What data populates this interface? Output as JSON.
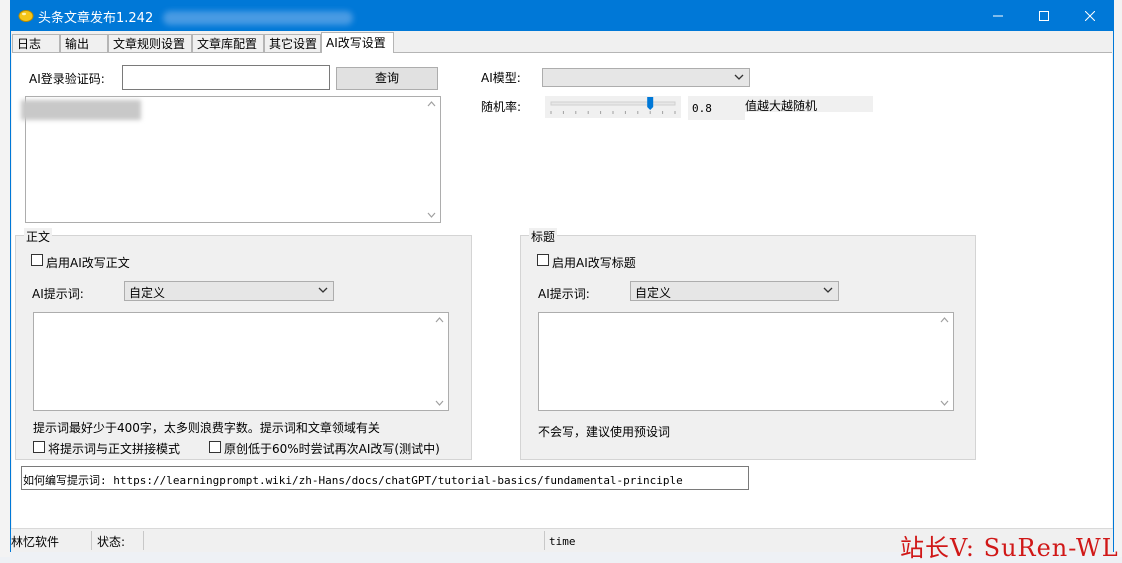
{
  "window": {
    "title": "头条文章发布1.242",
    "controls": [
      "minimize-icon",
      "maximize-icon",
      "close-icon"
    ]
  },
  "tabs": [
    {
      "label": "日志"
    },
    {
      "label": "输出"
    },
    {
      "label": "文章规则设置"
    },
    {
      "label": "文章库配置"
    },
    {
      "label": "其它设置"
    },
    {
      "label": "AI改写设置",
      "active": true
    }
  ],
  "login": {
    "code_label": "AI登录验证码:",
    "code_value": "",
    "query_button": "查询"
  },
  "model": {
    "label": "AI模型:",
    "selected": ""
  },
  "randomness": {
    "label": "随机率:",
    "value_fraction": 0.8,
    "value_text": "0.8",
    "hint": "值越大越随机"
  },
  "body_group": {
    "title": "正文",
    "enable_label": "启用AI改写正文",
    "prompt_label": "AI提示词:",
    "prompt_selected": "自定义",
    "hint": "提示词最好少于400字，太多则浪费字数。提示词和文章领域有关",
    "concat_label": "将提示词与正文拼接模式",
    "retry_label": "原创低于60%时尝试再次AI改写(测试中)"
  },
  "title_group": {
    "title": "标题",
    "enable_label": "启用AI改写标题",
    "prompt_label": "AI提示词:",
    "prompt_selected": "自定义",
    "hint": "不会写，建议使用预设词"
  },
  "help_link": "如何编写提示词: https://learningprompt.wiki/zh-Hans/docs/chatGPT/tutorial-basics/fundamental-principle",
  "statusbar": {
    "company": "林忆软件",
    "status_label": "状态:",
    "time_label": "time"
  },
  "watermark": "站长V: SuRen-WL",
  "colors": {
    "titlebar": "#0078d7",
    "watermark": "#d01818"
  }
}
